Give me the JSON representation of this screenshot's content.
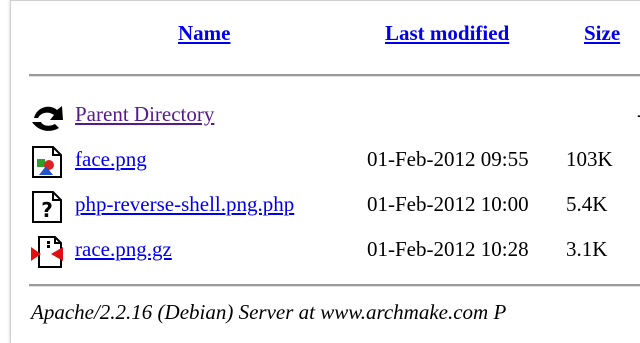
{
  "columns": {
    "name": "Name",
    "last_modified": "Last modified",
    "size": "Size"
  },
  "parent": {
    "icon": "back-arrow-icon",
    "label": "Parent Directory",
    "size": "-"
  },
  "rows": [
    {
      "icon": "image-file-icon",
      "name": "face.png",
      "modified": "01-Feb-2012 09:55",
      "size": "103K"
    },
    {
      "icon": "unknown-file-icon",
      "name": "php-reverse-shell.png.php",
      "modified": "01-Feb-2012 10:00",
      "size": "5.4K"
    },
    {
      "icon": "compressed-file-icon",
      "name": "race.png.gz",
      "modified": "01-Feb-2012 10:28",
      "size": "3.1K"
    }
  ],
  "footer": "Apache/2.2.16 (Debian) Server at www.archmake.com P"
}
